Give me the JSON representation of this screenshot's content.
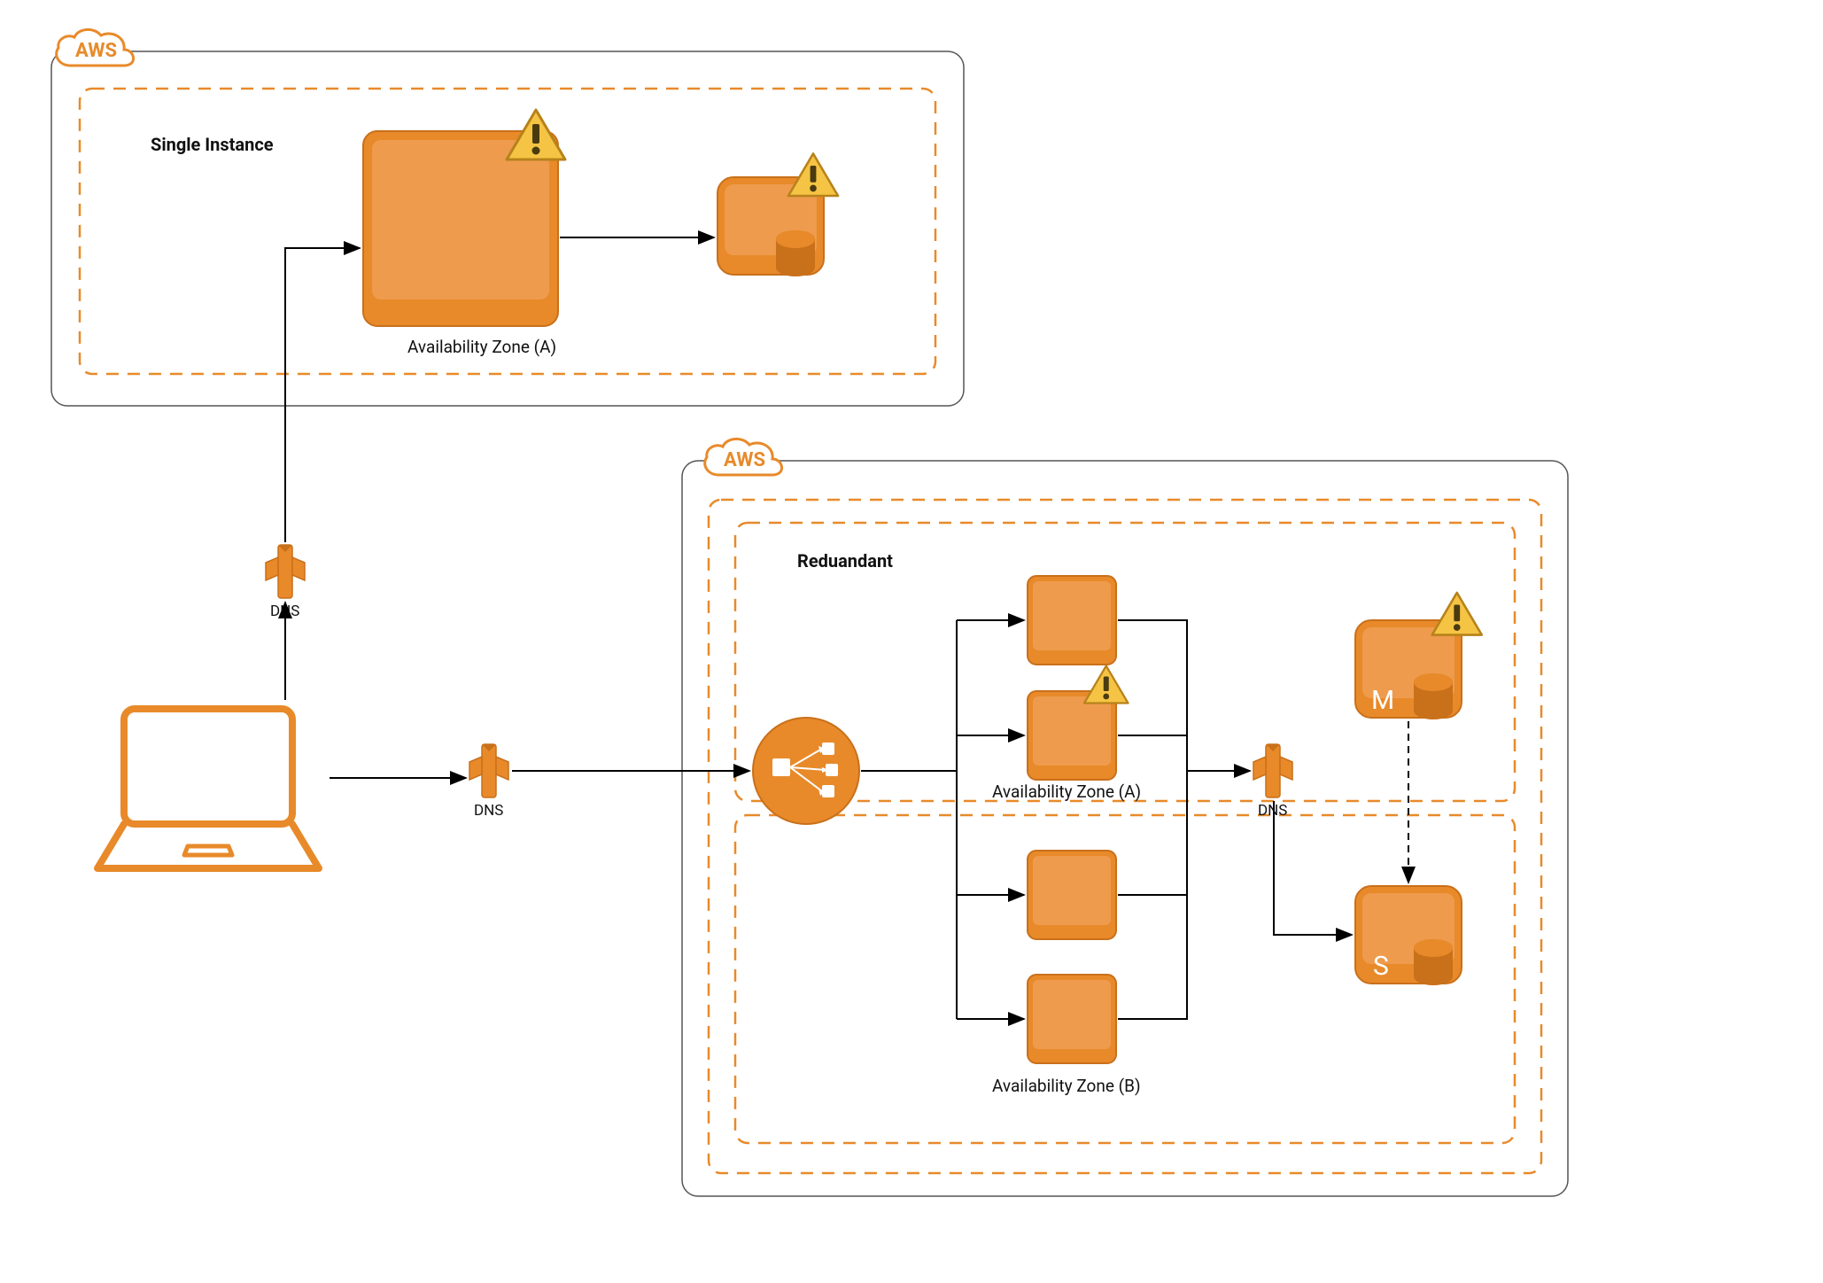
{
  "cloud_label_top": "AWS",
  "cloud_label_bottom": "AWS",
  "top_section_title": "Single Instance",
  "top_az_label": "Availability Zone (A)",
  "bottom_section_title": "Reduandant",
  "bottom_az_a_label": "Availability Zone (A)",
  "bottom_az_b_label": "Availability Zone (B)",
  "dns_label_1": "DNS",
  "dns_label_2": "DNS",
  "dns_label_3": "DNS",
  "db_master_letter": "M",
  "db_slave_letter": "S",
  "colors": {
    "aws_orange": "#E88A2A",
    "aws_orange_dark": "#C9701A",
    "warning_yellow": "#F5C444"
  }
}
